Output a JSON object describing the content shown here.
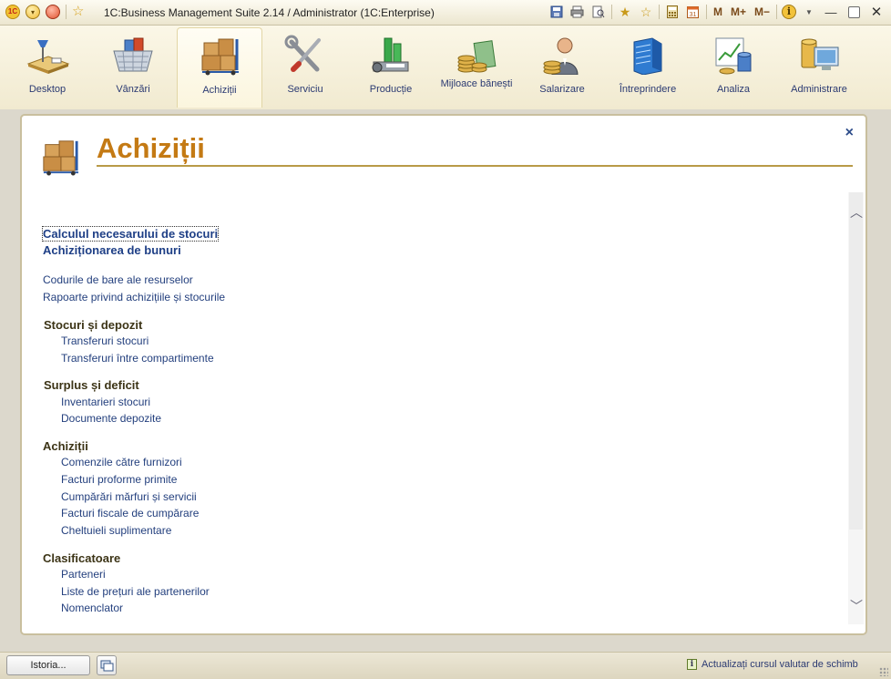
{
  "app": {
    "title": "1C:Business Management Suite 2.14 / Administrator  (1C:Enterprise)",
    "logo_text": "1C"
  },
  "toolbar": {
    "memory_buttons": [
      "M",
      "M+",
      "M−"
    ]
  },
  "sections": [
    {
      "label": "Desktop",
      "icon": "desktop-icon"
    },
    {
      "label": "Vânzări",
      "icon": "sales-basket-icon"
    },
    {
      "label": "Achiziții",
      "icon": "purchases-boxes-icon",
      "active": true
    },
    {
      "label": "Serviciu",
      "icon": "service-tools-icon"
    },
    {
      "label": "Producție",
      "icon": "production-factory-icon"
    },
    {
      "label": "Mijloace bănești",
      "icon": "money-coins-icon"
    },
    {
      "label": "Salarizare",
      "icon": "payroll-person-icon"
    },
    {
      "label": "Întreprindere",
      "icon": "enterprise-building-icon"
    },
    {
      "label": "Analiza",
      "icon": "analysis-chart-icon"
    },
    {
      "label": "Administrare",
      "icon": "administration-computer-icon"
    }
  ],
  "page": {
    "title": "Achiziții",
    "close": "×"
  },
  "nav": {
    "important_links": [
      "Calculul necesarului de stocuri",
      "Achiziționarea de bunuri"
    ],
    "links": [
      "Codurile de bare ale resurselor",
      "Rapoarte privind achizițiile și stocurile"
    ],
    "groups": [
      {
        "title": "Stocuri și depozit",
        "items": [
          "Transferuri stocuri",
          "Transferuri între compartimente"
        ]
      },
      {
        "title": "Surplus și deficit",
        "items": [
          "Inventarieri stocuri",
          "Documente depozite"
        ]
      },
      {
        "title": "Achiziții",
        "items": [
          "Comenzile către furnizori",
          "Facturi proforme primite",
          "Cumpărări mărfuri și servicii",
          "Facturi fiscale de cumpărare",
          "Cheltuieli suplimentare"
        ]
      },
      {
        "title": "Clasificatoare",
        "items": [
          "Parteneri",
          "Liste de prețuri ale partenerilor",
          "Nomenclator"
        ]
      }
    ]
  },
  "statusbar": {
    "history_button": "Istoria...",
    "message": "Actualizați cursul valutar de schimb"
  },
  "colors": {
    "title": "#c47a14",
    "link": "#24407e",
    "group_header": "#3c3416"
  }
}
